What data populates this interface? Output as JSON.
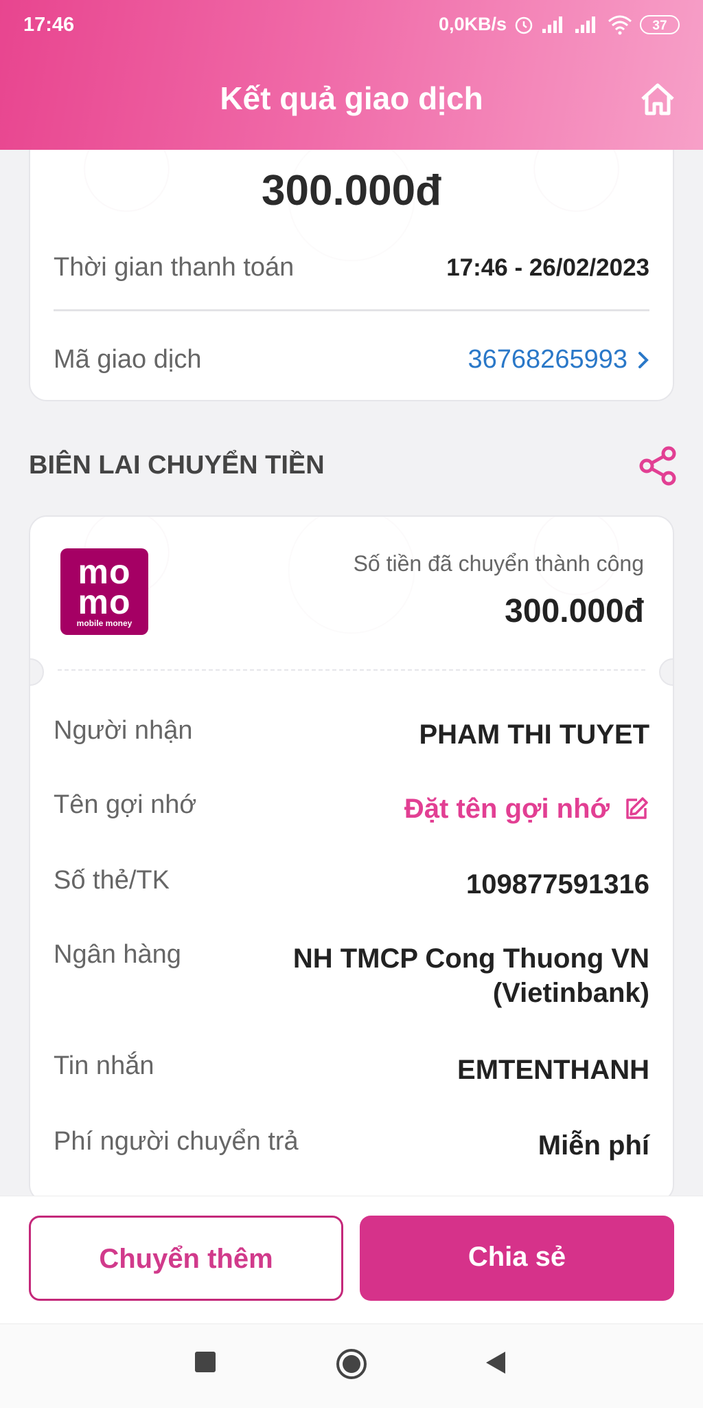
{
  "status_bar": {
    "time": "17:46",
    "network_speed": "0,0KB/s",
    "battery": "37"
  },
  "header": {
    "title": "Kết quả giao dịch",
    "home_icon": "home-icon"
  },
  "summary": {
    "amount": "300.000đ",
    "payment_time_label": "Thời gian thanh toán",
    "payment_time_value": "17:46 - 26/02/2023",
    "transaction_id_label": "Mã giao dịch",
    "transaction_id_value": "36768265993"
  },
  "receipt": {
    "section_title": "BIÊN LAI CHUYỂN TIỀN",
    "share_icon": "share-icon",
    "logo": {
      "line1": "mo",
      "line2": "mo",
      "tagline": "mobile money"
    },
    "success_label": "Số tiền đã chuyển thành công",
    "success_amount": "300.000đ",
    "rows": [
      {
        "label": "Người nhận",
        "value": "PHAM THI TUYET"
      },
      {
        "label": "Tên gợi nhớ",
        "value": "Đặt tên gợi nhớ"
      },
      {
        "label": "Số thẻ/TK",
        "value": "109877591316"
      },
      {
        "label": "Ngân hàng",
        "value": "NH TMCP Cong Thuong VN (Vietinbank)"
      },
      {
        "label": "Tin nhắn",
        "value": "EMTENTHANH"
      },
      {
        "label": "Phí người chuyển trả",
        "value": "Miễn phí"
      }
    ]
  },
  "actions": {
    "transfer_more": "Chuyển thêm",
    "share": "Chia sẻ"
  },
  "colors": {
    "brand_pink": "#d6328a",
    "link_blue": "#2a78c8",
    "momo_purple": "#a50064"
  }
}
